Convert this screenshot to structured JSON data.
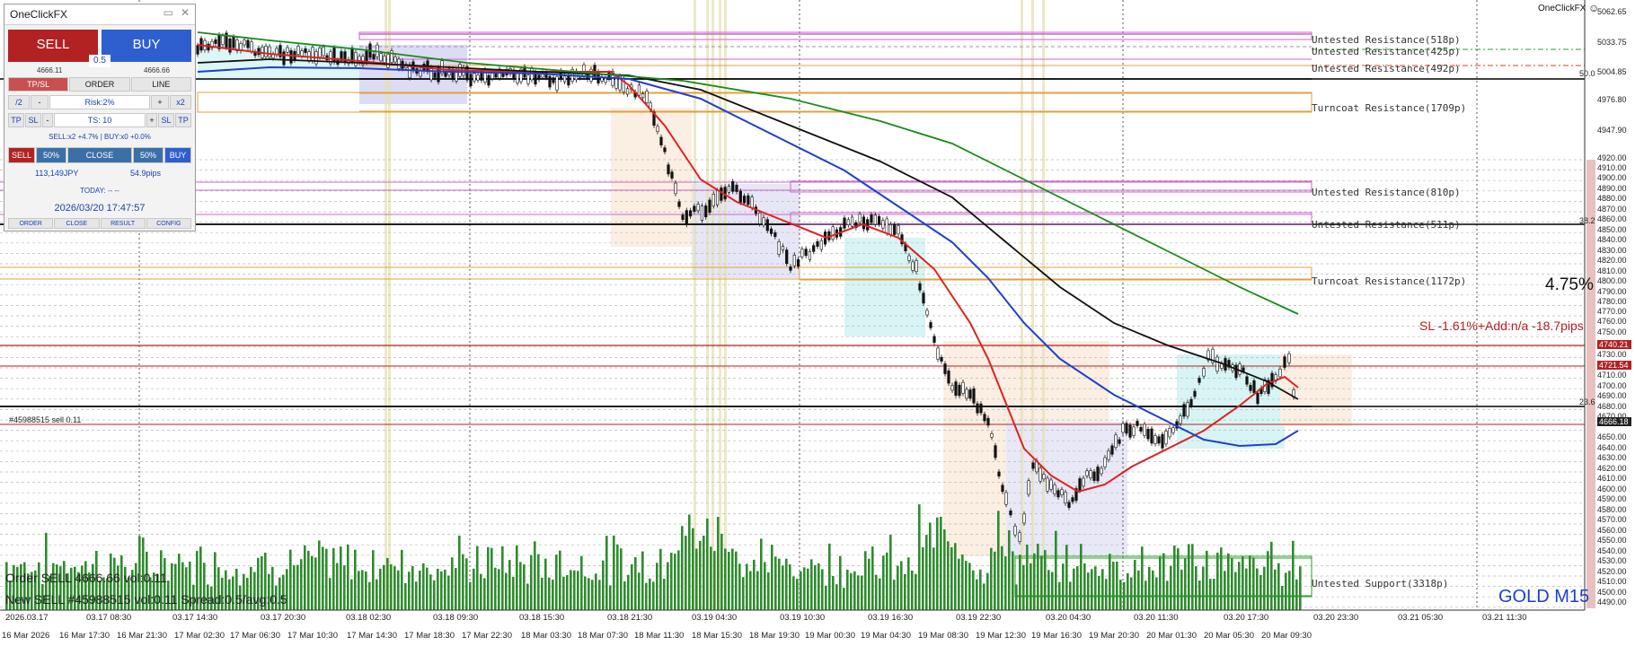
{
  "window": {
    "brand": "OneClickFX",
    "symbol_label": "GOLD M15",
    "percent_display": "4.75%",
    "sl_info": "SL -1.61%+Add:n/a -18.7pips",
    "order_tag": "#45988515 sell 0.11",
    "bottom_status_1": "Order SELL 4666.66 vol:0.11",
    "bottom_status_2": "New SELL #45988515 vol:0.11 Spread:0.5/avg:0.5"
  },
  "panel": {
    "title": "OneClickFX",
    "min_icon": "minimize-icon",
    "close_icon": "close-icon",
    "sell_label": "SELL",
    "buy_label": "BUY",
    "lot": "0.5",
    "sell_price": "4666.11",
    "buy_price": "4666.66",
    "tabs": [
      "TP/SL",
      "ORDER",
      "LINE"
    ],
    "row2": [
      "/2",
      "-",
      "Risk:2%",
      "+",
      "x2"
    ],
    "row3": [
      "TP",
      "SL",
      "-",
      "TS: 10",
      "+",
      "SL",
      "TP"
    ],
    "position_info": "SELL:x2 +4.7% | BUY:x0 +0.0%",
    "row5": [
      "SELL",
      "50%",
      "CLOSE",
      "50%",
      "BUY"
    ],
    "pnl": "113,149JPY",
    "pips": "54.9pips",
    "today": "TODAY: -- --",
    "datetime": "2026/03/20  17:47:57",
    "bottom_buttons": [
      "ORDER",
      "CLOSE",
      "RESULT",
      "CONFIG"
    ]
  },
  "levels": [
    {
      "label": "Untested Resistance(518p)",
      "color": "#cc66cc"
    },
    {
      "label": "Untested Resistance(425p)",
      "color": "#cc66cc"
    },
    {
      "label": "Untested Resistance(492p)",
      "color": "#cc66cc"
    },
    {
      "label": "Turncoat Resistance(1709p)",
      "color": "#e0a040"
    },
    {
      "label": "Untested Resistance(810p)",
      "color": "#cc66cc"
    },
    {
      "label": "Untested Resistance(511p)",
      "color": "#cc66cc"
    },
    {
      "label": "Turncoat Resistance(1172p)",
      "color": "#e0a040"
    },
    {
      "label": "Untested Support(3318p)",
      "color": "#2aa02a"
    }
  ],
  "fib_labels": [
    "50.0",
    "38.2",
    "23.6"
  ],
  "price_axis": {
    "labels": [
      "5062.65",
      "5033.75",
      "5004.85",
      "4976.80",
      "4947.90",
      "4920.00",
      "4910.00",
      "4900.00",
      "4890.00",
      "4880.00",
      "4870.00",
      "4860.00",
      "4850.00",
      "4840.00",
      "4830.00",
      "4820.00",
      "4810.00",
      "4800.00",
      "4790.00",
      "4780.00",
      "4770.00",
      "4760.00",
      "4750.00",
      "4740.21",
      "4730.00",
      "4721.54",
      "4710.00",
      "4700.00",
      "4690.00",
      "4680.00",
      "4670.00",
      "4666.18",
      "4650.00",
      "4640.00",
      "4630.00",
      "4620.00",
      "4610.00",
      "4600.00",
      "4590.00",
      "4580.00",
      "4570.00",
      "4560.00",
      "4550.00",
      "4540.00",
      "4530.00",
      "4520.00",
      "4510.00",
      "4500.00",
      "4490.00"
    ],
    "highlight": [
      {
        "value": "4740.21",
        "color": "#b22222"
      },
      {
        "value": "4721.54",
        "color": "#b22222"
      },
      {
        "value": "4666.18",
        "color": "#222222"
      }
    ]
  },
  "time_axis_upper": [
    "2026.03.17",
    "03.17 08:30",
    "03.17 14:30",
    "03.17 20:30",
    "03.18 02:30",
    "03.18 09:30",
    "03.18 15:30",
    "03.18 21:30",
    "03.19 04:30",
    "03.19 10:30",
    "03.19 16:30",
    "03.19 22:30",
    "03.20 04:30",
    "03.20 11:30",
    "03.20 17:30",
    "03.20 23:30",
    "03.21 05:30",
    "03.21 11:30"
  ],
  "time_axis_lower": [
    "16 Mar 2026",
    "16 Mar 17:30",
    "16 Mar 21:30",
    "17 Mar 02:30",
    "17 Mar 06:30",
    "17 Mar 10:30",
    "17 Mar 14:30",
    "17 Mar 18:30",
    "17 Mar 22:30",
    "18 Mar 03:30",
    "18 Mar 07:30",
    "18 Mar 11:30",
    "18 Mar 15:30",
    "18 Mar 19:30",
    "19 Mar 00:30",
    "19 Mar 04:30",
    "19 Mar 08:30",
    "19 Mar 12:30",
    "19 Mar 16:30",
    "19 Mar 20:30",
    "20 Mar 01:30",
    "20 Mar 05:30",
    "20 Mar 09:30"
  ],
  "colors": {
    "sell": "#b22222",
    "buy": "#2f5fcf",
    "ma_fast": "#e02020",
    "ma_mid": "#1f3fd0",
    "ma_slow": "#111111",
    "ma_long": "#1a8a1a",
    "volume": "#2e8b2e"
  }
}
